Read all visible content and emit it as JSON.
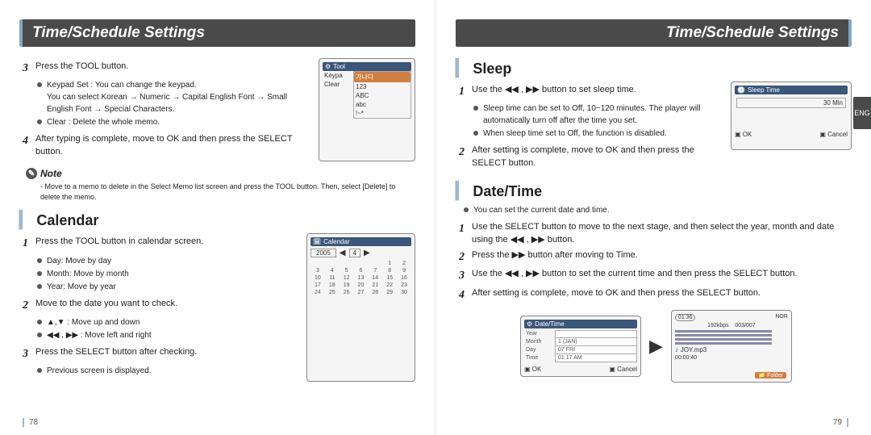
{
  "header_left": "Time/Schedule Settings",
  "header_right": "Time/Schedule Settings",
  "side_tab": "ENG",
  "page_left": "78",
  "page_right": "79",
  "left": {
    "step3": "Press the TOOL button.",
    "step3_bullets": [
      "Keypad Set : You can change the keypad.\nYou can select Korean → Numeric → Capital English Font → Small English Font → Special Characters.",
      "Clear : Delete the whole memo."
    ],
    "step4": "After typing is complete, move to OK and then press the SELECT button.",
    "note_label": "Note",
    "note_body": "- Move to a memo to delete in the Select Memo list screen and press the TOOL button. Then, select [Delete] to delete the memo.",
    "calendar_title": "Calendar",
    "cal_step1": "Press the TOOL button in calendar screen.",
    "cal_step1_bullets": [
      "Day: Move by day",
      "Month: Move by month",
      "Year: Move by year"
    ],
    "cal_step2": "Move to the date you want to check.",
    "cal_step2_bullets": [
      "▲,▼ : Move up and down",
      "◀◀ , ▶▶ : Move left and right"
    ],
    "cal_step3": "Press the SELECT button after checking.",
    "cal_step3_bullets": [
      "Previous screen is displayed."
    ],
    "tool_widget": {
      "title": "Tool",
      "row_keypad": "Keypa",
      "row_clear": "Clear",
      "options": [
        "가나다",
        "123",
        "ABC",
        "abc",
        "!~*"
      ]
    },
    "calendar_widget": {
      "title": "Calendar",
      "year": "2005",
      "month": "4",
      "cells": [
        [
          "",
          "",
          "",
          "",
          "",
          "1",
          "2"
        ],
        [
          "3",
          "4",
          "5",
          "6",
          "7",
          "8",
          "9"
        ],
        [
          "10",
          "11",
          "12",
          "13",
          "14",
          "15",
          "16"
        ],
        [
          "17",
          "18",
          "19",
          "20",
          "21",
          "22",
          "23"
        ],
        [
          "24",
          "25",
          "26",
          "27",
          "28",
          "29",
          "30"
        ]
      ]
    }
  },
  "right": {
    "sleep_title": "Sleep",
    "sleep_step1": "Use the  ◀◀ , ▶▶  button to set sleep time.",
    "sleep_step1_bullets": [
      "Sleep time can be set to Off, 10~120 minutes. The player will automatically turn off after the time you set.",
      "When sleep time set to Off, the function is disabled."
    ],
    "sleep_step2": "After setting is complete, move to OK and then press the SELECT button.",
    "sleep_widget": {
      "title": "Sleep Time",
      "value": "30 Min",
      "ok": "OK",
      "cancel": "Cancel"
    },
    "dt_title": "Date/Time",
    "dt_intro": "You can set the current date and time.",
    "dt_step1": "Use the SELECT button to move to the next stage, and then select the year, month and date using the  ◀◀ , ▶▶  button.",
    "dt_step2": "Press the  ▶▶  button after moving to Time.",
    "dt_step3": "Use the ◀◀ , ▶▶ button to set the current time and then press the SELECT button.",
    "dt_step4": "After setting is complete, move to OK and then press the SELECT button.",
    "dt_widget": {
      "title": "Date/Time",
      "rows": [
        [
          "Year",
          ""
        ],
        [
          "Month",
          "1 (JAN)"
        ],
        [
          "Day",
          "07 FRI"
        ],
        [
          "Time",
          "01:17 AM"
        ]
      ],
      "ok": "OK",
      "cancel": "Cancel"
    },
    "player_widget": {
      "time": "01:36",
      "rate": "192kbps",
      "track": "003/007",
      "file": "JOY.mp3",
      "elapsed": "00:00:40",
      "folder": "Folder",
      "mode": "NOR"
    }
  }
}
